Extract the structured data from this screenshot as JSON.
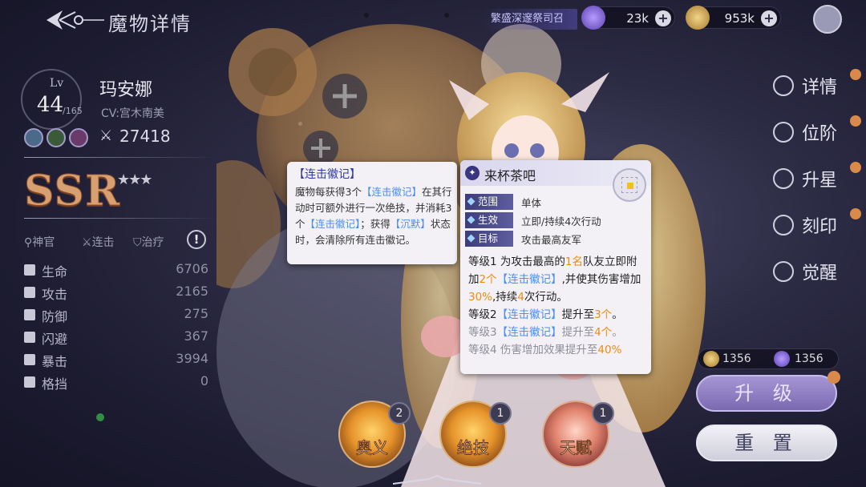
{
  "header": {
    "title": "魔物详情",
    "event_banner": "繁盛深邃祭司召"
  },
  "resources": [
    {
      "name": "gem",
      "value": "23k",
      "icon": "purple-crystal-icon",
      "color": "#7a5fd1"
    },
    {
      "name": "gold",
      "value": "953k",
      "icon": "gold-coin-icon",
      "color": "#c99a3b"
    }
  ],
  "character": {
    "lv_label": "Lv",
    "level": "44",
    "level_max": "/165",
    "name": "玛安娜",
    "cv": "CV:宫木南美",
    "power": "27418",
    "rarity": "SSR",
    "stars": "★★★",
    "tags": [
      "神官",
      "连击",
      "治疗"
    ],
    "help": "!"
  },
  "stats": [
    {
      "name": "生命",
      "value": "6706"
    },
    {
      "name": "攻击",
      "value": "2165"
    },
    {
      "name": "防御",
      "value": "275"
    },
    {
      "name": "闪避",
      "value": "367"
    },
    {
      "name": "暴击",
      "value": "3994"
    },
    {
      "name": "格挡",
      "value": "0"
    }
  ],
  "tooltip_combo": {
    "title": "【连击徽记】",
    "line1_a": "魔物每获得3个",
    "kw1": "【连击徽记】",
    "line1_b": "在其行动时可额外进行一次绝技，并消耗3个",
    "kw2": "【连击徽记】",
    "line1_c": "；获得",
    "kw3": "【沉默】",
    "line1_d": "状态时，会清除所有连击徽记。"
  },
  "tooltip_skill": {
    "title": "来杯茶吧",
    "rows": [
      {
        "key": "范围",
        "value": "单体"
      },
      {
        "key": "生效",
        "value": "立即/持续4次行动"
      },
      {
        "key": "目标",
        "value": "攻击最高友军"
      }
    ],
    "lv1_a": "等级1 为攻击最高的",
    "lv1_num": "1名",
    "lv1_b": "队友立即附加",
    "lv1_cnt": "2个",
    "lv1_kw": "【连击徽记】",
    "lv1_c": ",并使其伤害增加",
    "lv1_pct": "30%",
    "lv1_d": ",持续",
    "lv1_turns": "4",
    "lv1_e": "次行动。",
    "lv2_a": "等级2",
    "lv2_kw": "【连击徽记】",
    "lv2_b": "提升至",
    "lv2_val": "3个",
    "lv2_c": "。",
    "lv3_a": "等级3",
    "lv3_kw": "【连击徽记】",
    "lv3_b": "提升至",
    "lv3_val": "4个",
    "lv3_c": "。",
    "lv4_a": "等级4 伤害增加效果提升至",
    "lv4_val": "40%"
  },
  "nav": [
    "详情",
    "位阶",
    "升星",
    "刻印",
    "觉醒"
  ],
  "cost": {
    "coin": "1356",
    "crystal": "1356"
  },
  "buttons": {
    "upgrade": "升 级",
    "reset": "重 置"
  },
  "skills": [
    {
      "label": "奥义",
      "count": "2"
    },
    {
      "label": "绝技",
      "count": "1"
    },
    {
      "label": "天赋",
      "count": "1"
    }
  ]
}
